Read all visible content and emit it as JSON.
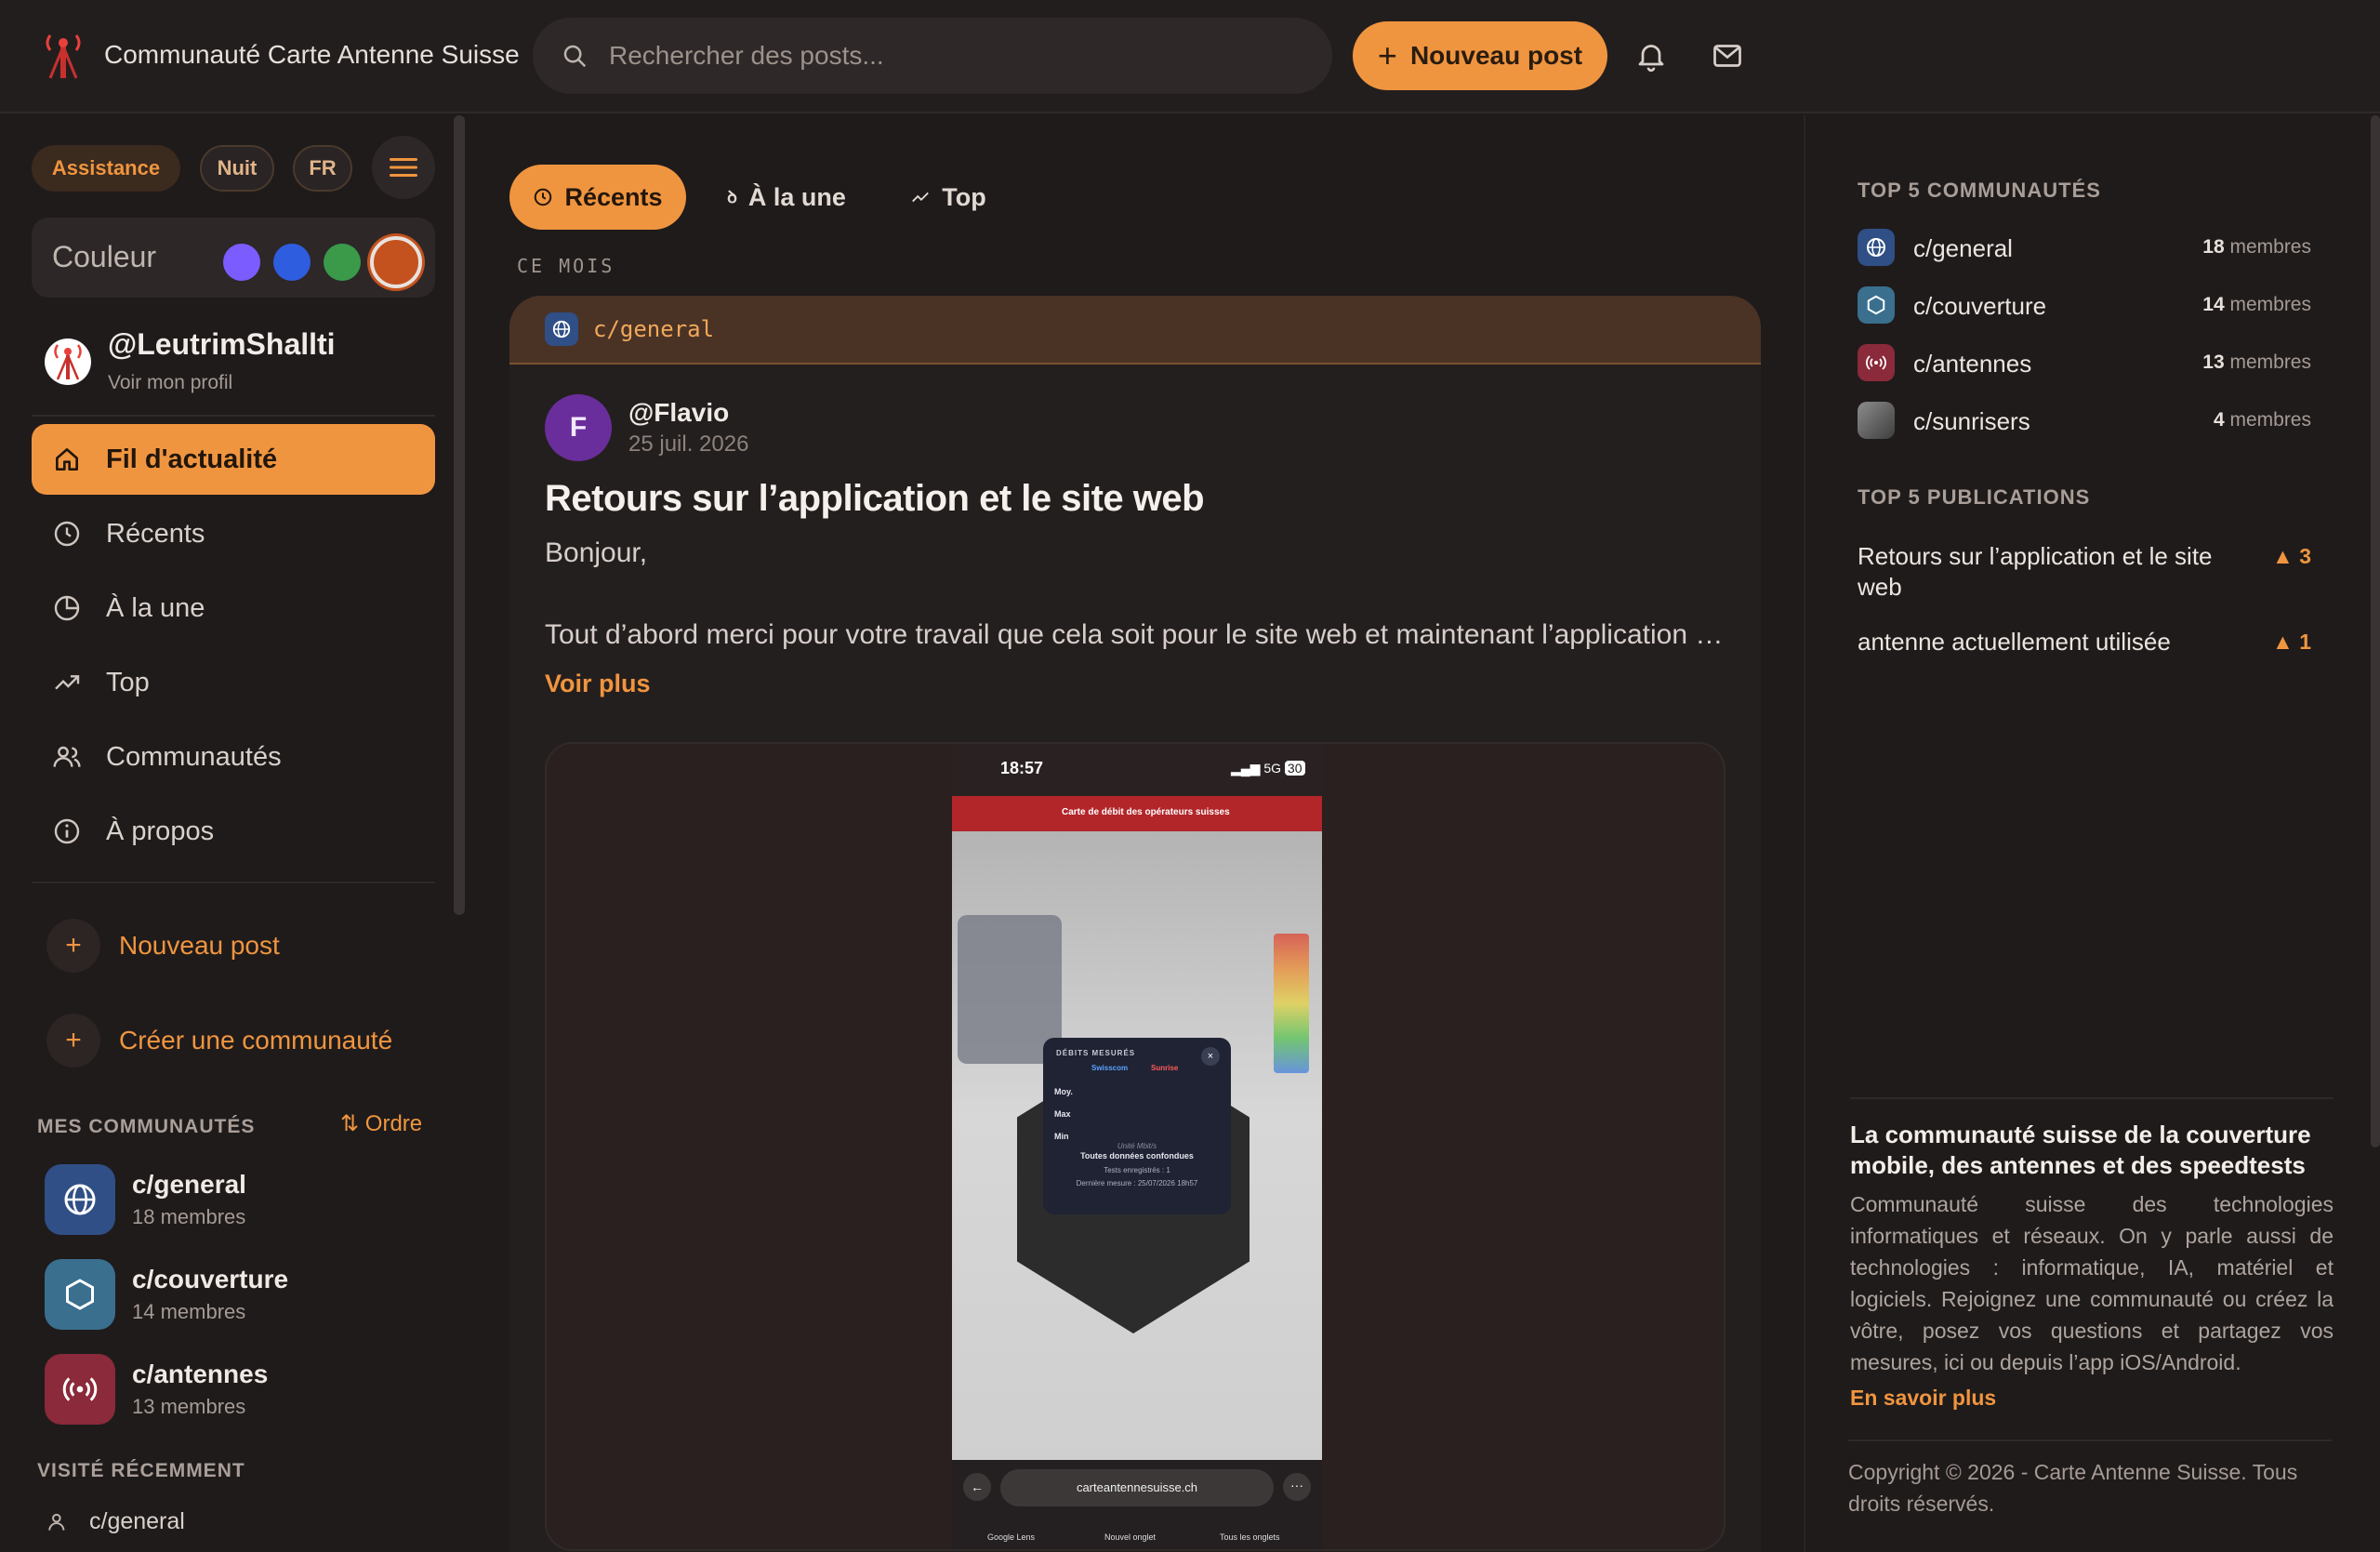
{
  "app": {
    "title": "Communauté Carte Antenne Suisse"
  },
  "search": {
    "placeholder": "Rechercher des posts..."
  },
  "header": {
    "new_post_label": "Nouveau post"
  },
  "colors": {
    "accent": "#f0953f",
    "background": "#1f1b1b",
    "swatches": [
      "#7b5cff",
      "#2f5de0",
      "#3a9a4a",
      "#c4521e"
    ]
  },
  "sidebar": {
    "pills": {
      "assistance": "Assistance",
      "night": "Nuit",
      "lang": "FR"
    },
    "color_label": "Couleur",
    "profile": {
      "username": "@LeutrimShallti",
      "link": "Voir mon profil"
    },
    "nav": [
      {
        "label": "Fil d'actualité",
        "icon": "home-icon",
        "active": true
      },
      {
        "label": "Récents",
        "icon": "clock-icon"
      },
      {
        "label": "À la une",
        "icon": "trending-circle-icon"
      },
      {
        "label": "Top",
        "icon": "trend-up-icon"
      },
      {
        "label": "Communautés",
        "icon": "users-icon"
      },
      {
        "label": "À propos",
        "icon": "info-icon"
      }
    ],
    "actions": {
      "new_post": "Nouveau post",
      "create_community": "Créer une communauté"
    },
    "my_communities_title": "MES COMMUNAUTÉS",
    "order_label": "Ordre",
    "communities": [
      {
        "name": "c/general",
        "members": "18 membres",
        "icon": "globe-icon",
        "color": "#2f4f86"
      },
      {
        "name": "c/couverture",
        "members": "14 membres",
        "icon": "hexagon-icon",
        "color": "#3a6f8e"
      },
      {
        "name": "c/antennes",
        "members": "13 membres",
        "icon": "broadcast-icon",
        "color": "#8a2a3a"
      }
    ],
    "recent_title": "VISITÉ RÉCEMMENT",
    "recent": [
      {
        "name": "c/general"
      }
    ]
  },
  "feed": {
    "tabs": [
      {
        "label": "Récents",
        "active": true
      },
      {
        "label": "À la une"
      },
      {
        "label": "Top"
      }
    ],
    "period_label": "CE MOIS",
    "post": {
      "community": "c/general",
      "author_initial": "F",
      "author": "@Flavio",
      "date": "25 juil. 2026",
      "title": "Retours sur l’application et le site web",
      "greeting": "Bonjour,",
      "excerpt": "Tout d’abord merci pour votre travail que cela soit pour le site web et maintenant l’application mobile, qui sont très utiles pour la communauté",
      "see_more": "Voir plus",
      "screenshot": {
        "time": "18:57",
        "signal": "5G",
        "battery": "30",
        "app_header": "Carte de débit des opérateurs suisses",
        "popup_title": "DÉBITS MESURÉS",
        "op1": "Swisscom",
        "op2": "Sunrise",
        "rows": [
          "Moy.",
          "Max",
          "Min"
        ],
        "unit_label": "Unité Mbit/s",
        "confused": "Toutes données confondues",
        "tests": "Tests enregistrés : 1",
        "last": "Dernière mesure : 25/07/2026 18h57",
        "url": "carteantennesuisse.ch",
        "nav": [
          "Google Lens",
          "Nouvel onglet",
          "Tous les onglets"
        ]
      }
    }
  },
  "right": {
    "top_communities_title": "TOP 5 COMMUNAUTÉS",
    "top_communities": [
      {
        "name": "c/general",
        "count": "18",
        "unit": "membres",
        "color": "#2f4f86"
      },
      {
        "name": "c/couverture",
        "count": "14",
        "unit": "membres",
        "color": "#3a6f8e"
      },
      {
        "name": "c/antennes",
        "count": "13",
        "unit": "membres",
        "color": "#8a2a3a"
      },
      {
        "name": "c/sunrisers",
        "count": "4",
        "unit": "membres",
        "color": "#555555"
      }
    ],
    "top_posts_title": "TOP 5 PUBLICATIONS",
    "top_posts": [
      {
        "title": "Retours sur l’application et le site web",
        "votes": "▲ 3"
      },
      {
        "title": "antenne actuellement utilisée",
        "votes": "▲ 1"
      }
    ],
    "about": {
      "heading": "La communauté suisse de la couverture mobile, des antennes et des speedtests",
      "body": "Communauté suisse des technologies informatiques et réseaux. On y parle aussi de technologies : informatique, IA, matériel et logiciels. Rejoignez une communauté ou créez la vôtre, posez vos questions et partagez vos mesures, ici ou depuis l’app iOS/Android.",
      "more": "En savoir plus"
    },
    "copyright": "Copyright © 2026 - Carte Antenne Suisse. Tous droits réservés."
  }
}
